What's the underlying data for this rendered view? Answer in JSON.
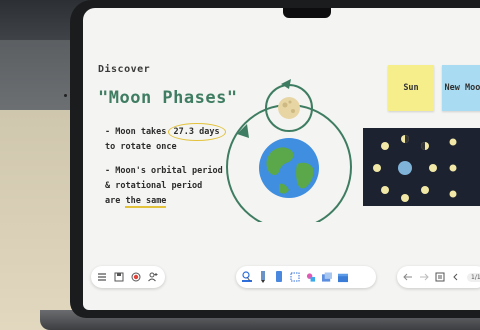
{
  "board": {
    "discover_label": "Discover",
    "title": "\"Moon Phases\"",
    "bullet1_line1_a": "- Moon takes ",
    "bullet1_days": "27.3 days",
    "bullet1_line2": "to rotate once",
    "bullet2_line1": "- Moon's orbital period",
    "bullet2_line2": "& rotational period",
    "bullet2_line3_a": "are ",
    "bullet2_same": "the same"
  },
  "stickies": {
    "sun": "Sun",
    "new_moon": "New Moon"
  },
  "toolbar": {
    "page_indicator": "1/1"
  },
  "icons": {
    "left": [
      "menu-icon",
      "save-icon",
      "record-icon",
      "add-user-icon"
    ],
    "middle": [
      "pen-icon",
      "marker-icon",
      "eraser-icon",
      "select-icon",
      "shapes-icon",
      "insert-icon",
      "box-icon"
    ],
    "right": [
      "undo-icon",
      "redo-icon",
      "notes-icon",
      "prev-page-icon"
    ]
  },
  "colors": {
    "title_green": "#3f7d62",
    "highlight_yellow": "#e2c23a",
    "sticky_yellow": "#f6ee8a",
    "sticky_blue": "#a9dcf2",
    "orbit_green": "#3f7d62"
  }
}
